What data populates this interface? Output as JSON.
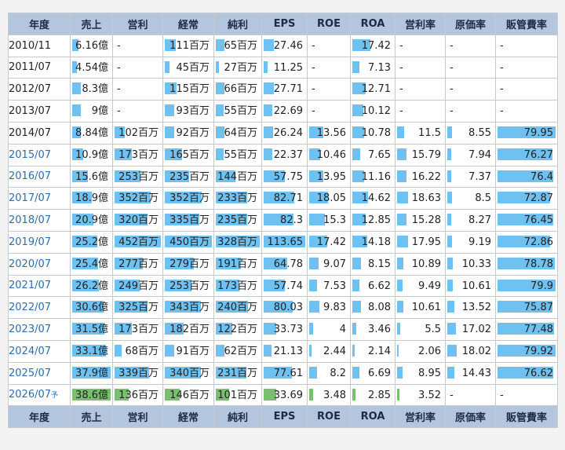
{
  "headers": [
    "年度",
    "売上",
    "営利",
    "経常",
    "純利",
    "EPS",
    "ROE",
    "ROA",
    "営利率",
    "原価率",
    "販管費率"
  ],
  "rows": [
    {
      "year": "2010/11",
      "link": false,
      "cells": [
        "6.16億",
        "-",
        "111百万",
        "65百万",
        "27.46",
        "-",
        "17.42",
        "-",
        "-",
        "-"
      ],
      "fills": [
        0.16,
        0,
        0.24,
        0.19,
        0.24,
        0,
        0.45,
        0,
        0,
        0
      ]
    },
    {
      "year": "2011/07",
      "link": false,
      "cells": [
        "4.54億",
        "-",
        "45百万",
        "27百万",
        "11.25",
        "-",
        "7.13",
        "-",
        "-",
        "-"
      ],
      "fills": [
        0.12,
        0,
        0.1,
        0.08,
        0.1,
        0,
        0.18,
        0,
        0,
        0
      ]
    },
    {
      "year": "2012/07",
      "link": false,
      "cells": [
        "8.3億",
        "-",
        "115百万",
        "66百万",
        "27.71",
        "-",
        "12.71",
        "-",
        "-",
        "-"
      ],
      "fills": [
        0.22,
        0,
        0.25,
        0.2,
        0.24,
        0,
        0.33,
        0,
        0,
        0
      ]
    },
    {
      "year": "2013/07",
      "link": false,
      "cells": [
        "9億",
        "-",
        "93百万",
        "55百万",
        "22.69",
        "-",
        "10.12",
        "-",
        "-",
        "-"
      ],
      "fills": [
        0.23,
        0,
        0.2,
        0.17,
        0.2,
        0,
        0.26,
        0,
        0,
        0
      ]
    },
    {
      "year": "2014/07",
      "link": false,
      "cells": [
        "8.84億",
        "102百万",
        "92百万",
        "64百万",
        "26.24",
        "13.56",
        "10.78",
        "11.5",
        "8.55",
        "79.95"
      ],
      "fills": [
        0.23,
        0.22,
        0.2,
        0.19,
        0.23,
        0.35,
        0.28,
        0.15,
        0.1,
        1.0
      ]
    },
    {
      "year": "2015/07",
      "link": true,
      "cells": [
        "10.9億",
        "173百万",
        "165百万",
        "55百万",
        "22.37",
        "10.46",
        "7.65",
        "15.79",
        "7.94",
        "76.27"
      ],
      "fills": [
        0.29,
        0.38,
        0.36,
        0.17,
        0.2,
        0.27,
        0.2,
        0.2,
        0.09,
        0.95
      ]
    },
    {
      "year": "2016/07",
      "link": true,
      "cells": [
        "15.6億",
        "253百万",
        "235百万",
        "144百万",
        "57.75",
        "13.95",
        "11.16",
        "16.22",
        "7.37",
        "76.4"
      ],
      "fills": [
        0.41,
        0.56,
        0.52,
        0.44,
        0.51,
        0.36,
        0.29,
        0.21,
        0.08,
        0.96
      ]
    },
    {
      "year": "2017/07",
      "link": true,
      "cells": [
        "18.9億",
        "352百万",
        "352百万",
        "233百万",
        "82.71",
        "18.05",
        "14.62",
        "18.63",
        "8.5",
        "72.87"
      ],
      "fills": [
        0.5,
        0.78,
        0.78,
        0.71,
        0.73,
        0.47,
        0.38,
        0.24,
        0.1,
        0.91
      ]
    },
    {
      "year": "2018/07",
      "link": true,
      "cells": [
        "20.9億",
        "320百万",
        "335百万",
        "235百万",
        "82.3",
        "15.3",
        "12.85",
        "15.28",
        "8.27",
        "76.45"
      ],
      "fills": [
        0.55,
        0.71,
        0.74,
        0.72,
        0.72,
        0.4,
        0.33,
        0.2,
        0.09,
        0.96
      ]
    },
    {
      "year": "2019/07",
      "link": true,
      "cells": [
        "25.2億",
        "452百万",
        "450百万",
        "328百万",
        "113.65",
        "17.42",
        "14.18",
        "17.95",
        "9.19",
        "72.86"
      ],
      "fills": [
        0.66,
        1.0,
        1.0,
        1.0,
        1.0,
        0.45,
        0.37,
        0.23,
        0.1,
        0.91
      ]
    },
    {
      "year": "2020/07",
      "link": true,
      "cells": [
        "25.4億",
        "277百万",
        "279百万",
        "191百万",
        "64.78",
        "9.07",
        "8.15",
        "10.89",
        "10.33",
        "78.78"
      ],
      "fills": [
        0.67,
        0.61,
        0.62,
        0.58,
        0.57,
        0.24,
        0.21,
        0.14,
        0.12,
        0.99
      ]
    },
    {
      "year": "2021/07",
      "link": true,
      "cells": [
        "26.2億",
        "249百万",
        "253百万",
        "173百万",
        "57.74",
        "7.53",
        "6.62",
        "9.49",
        "10.61",
        "79.9"
      ],
      "fills": [
        0.69,
        0.55,
        0.56,
        0.53,
        0.51,
        0.2,
        0.17,
        0.12,
        0.12,
        1.0
      ]
    },
    {
      "year": "2022/07",
      "link": true,
      "cells": [
        "30.6億",
        "325百万",
        "343百万",
        "240百万",
        "80.03",
        "9.83",
        "8.08",
        "10.61",
        "13.52",
        "75.87"
      ],
      "fills": [
        0.81,
        0.72,
        0.76,
        0.73,
        0.7,
        0.26,
        0.21,
        0.14,
        0.15,
        0.95
      ]
    },
    {
      "year": "2023/07",
      "link": true,
      "cells": [
        "31.5億",
        "173百万",
        "182百万",
        "122百万",
        "33.73",
        "4",
        "3.46",
        "5.5",
        "17.02",
        "77.48"
      ],
      "fills": [
        0.83,
        0.38,
        0.4,
        0.37,
        0.3,
        0.1,
        0.09,
        0.07,
        0.19,
        0.97
      ]
    },
    {
      "year": "2024/07",
      "link": true,
      "cells": [
        "33.1億",
        "68百万",
        "91百万",
        "62百万",
        "21.13",
        "2.44",
        "2.14",
        "2.06",
        "18.02",
        "79.92"
      ],
      "fills": [
        0.87,
        0.15,
        0.2,
        0.19,
        0.19,
        0.06,
        0.06,
        0.03,
        0.2,
        1.0
      ]
    },
    {
      "year": "2025/07",
      "link": true,
      "cells": [
        "37.9億",
        "339百万",
        "340百万",
        "231百万",
        "77.61",
        "8.2",
        "6.69",
        "8.95",
        "14.43",
        "76.62"
      ],
      "fills": [
        1.0,
        0.75,
        0.76,
        0.7,
        0.68,
        0.21,
        0.17,
        0.12,
        0.16,
        0.96
      ]
    },
    {
      "year": "2026/07",
      "yosoku": "予",
      "link": true,
      "forecast": true,
      "cells": [
        "38.6億",
        "136百万",
        "146百万",
        "101百万",
        "33.69",
        "3.48",
        "2.85",
        "3.52",
        "-",
        "-"
      ],
      "fills": [
        1.0,
        0.3,
        0.32,
        0.31,
        0.3,
        0.09,
        0.07,
        0.05,
        0,
        0
      ]
    }
  ]
}
